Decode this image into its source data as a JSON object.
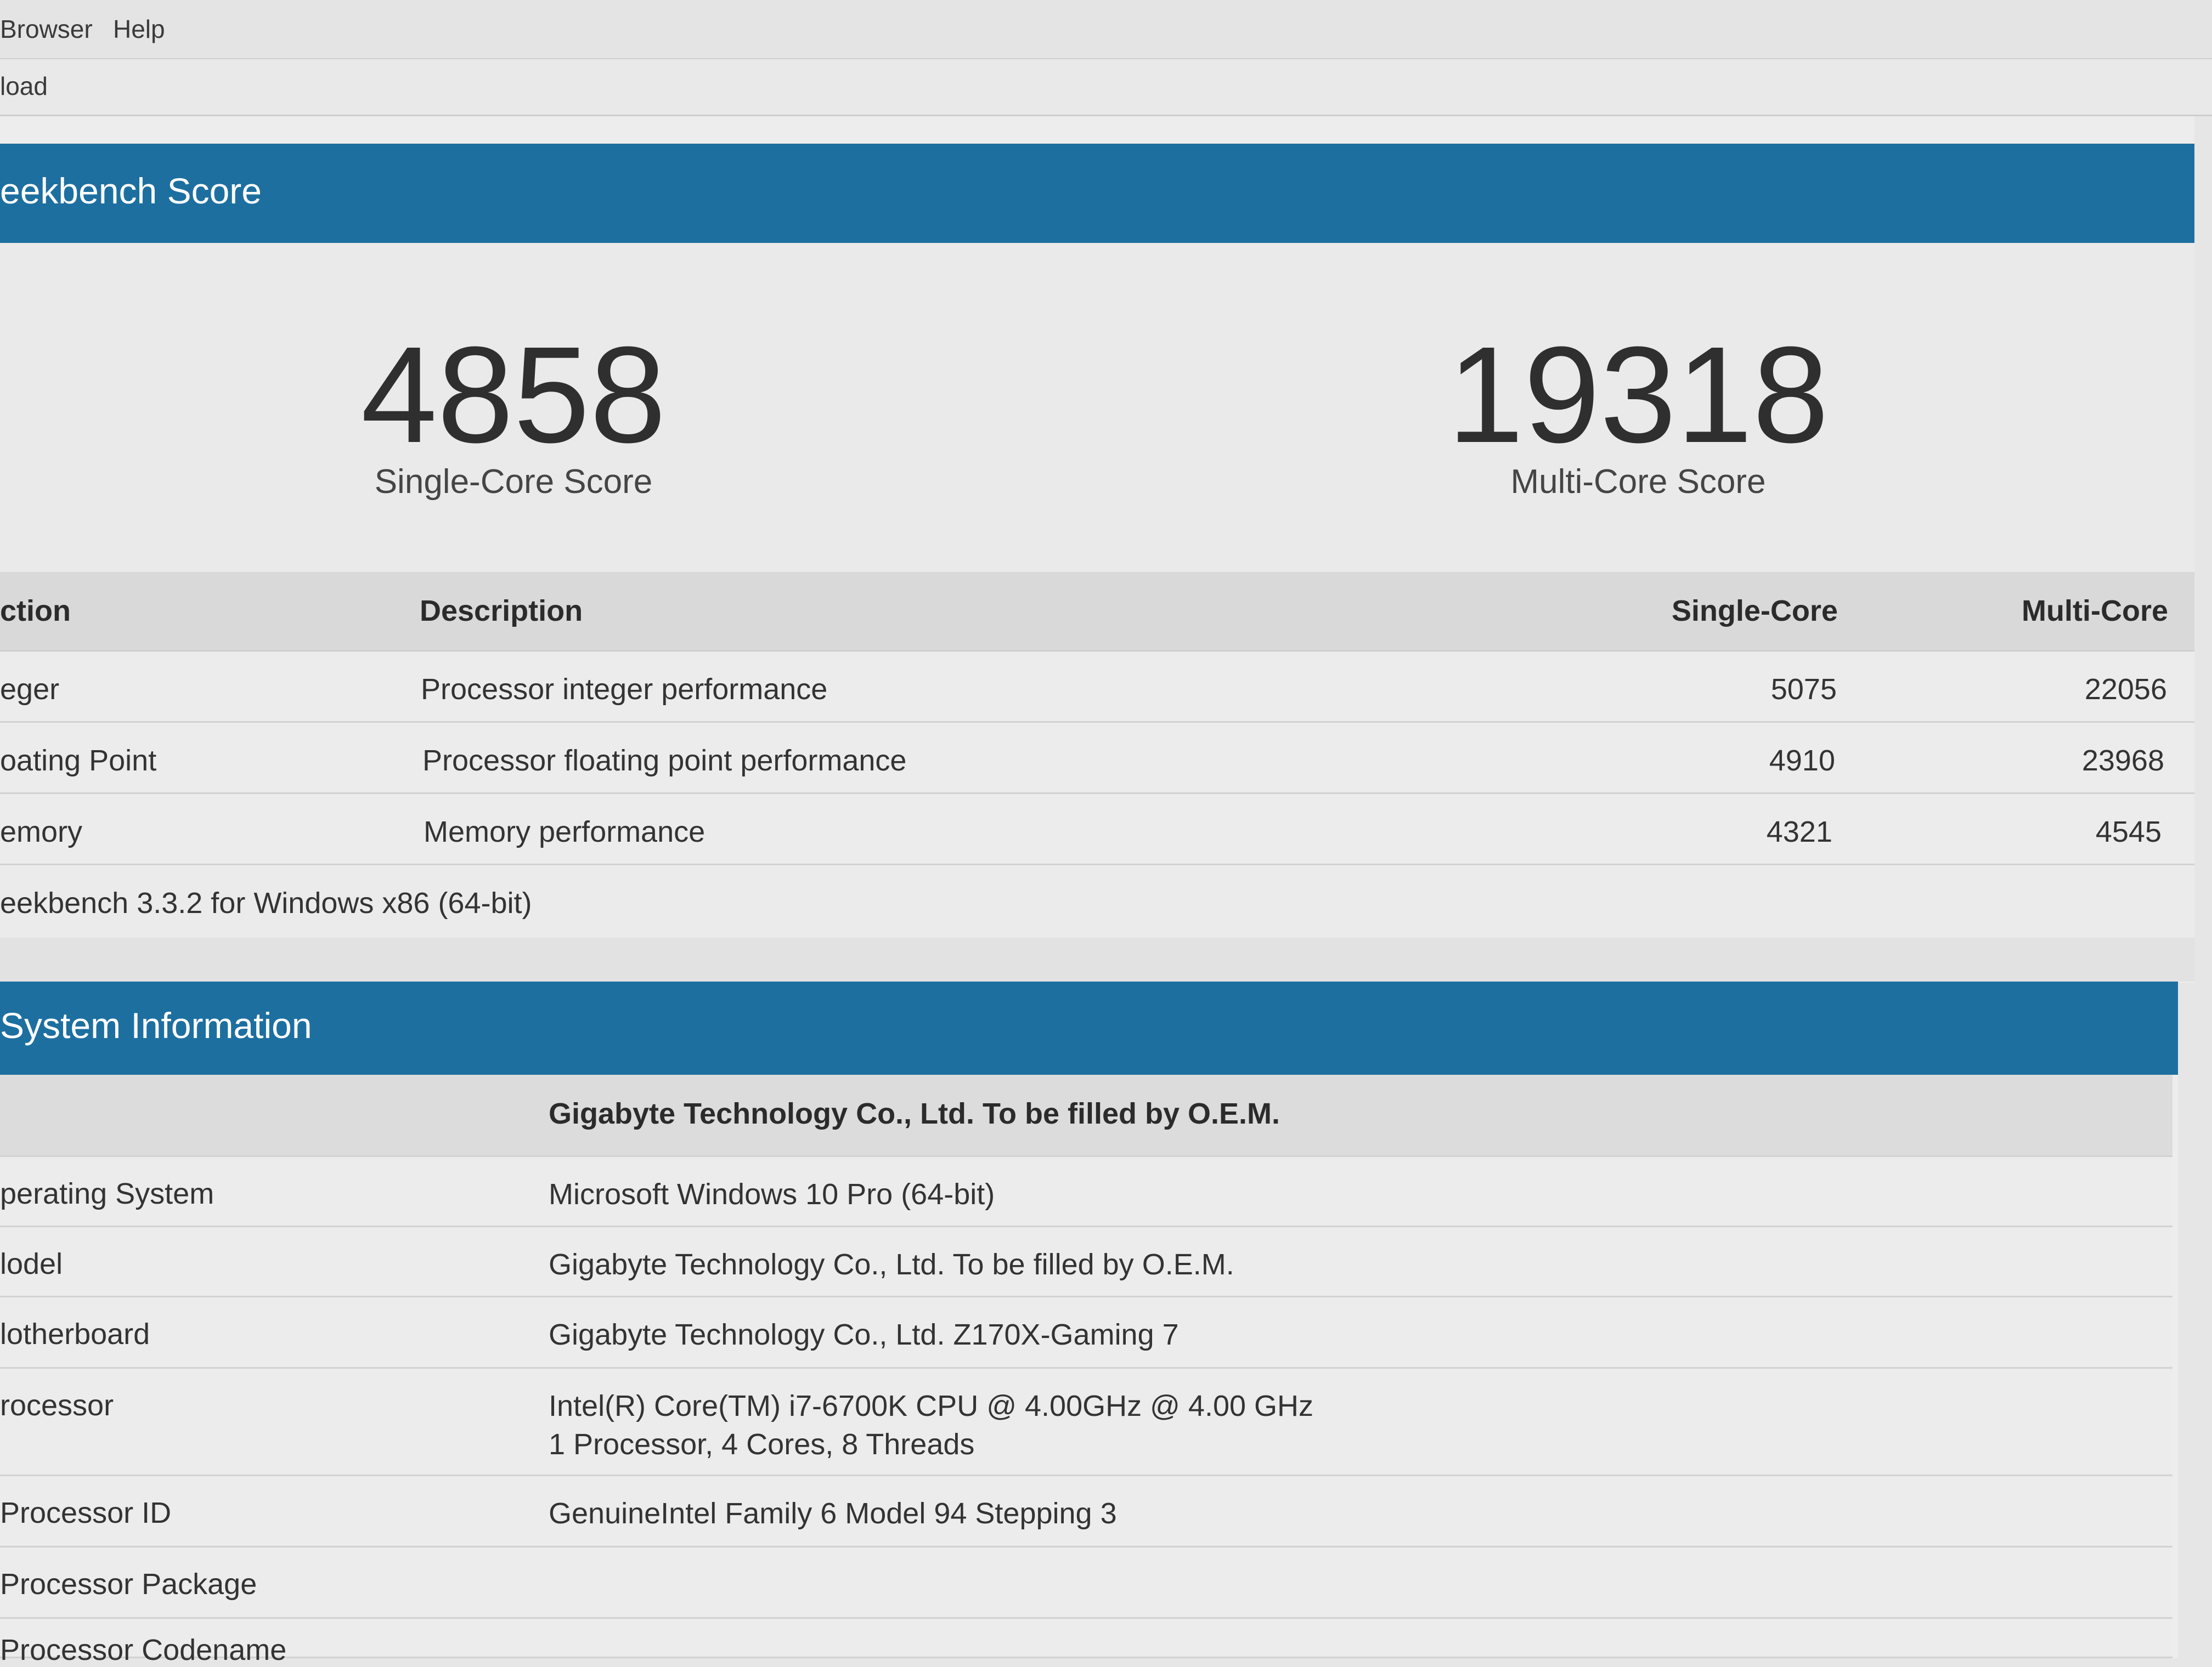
{
  "menu": {
    "items": [
      "Browser",
      "Help"
    ]
  },
  "toolbar": {
    "item": "load"
  },
  "score_section": {
    "title": "eekbench Score",
    "single_core_value": "4858",
    "single_core_label": "Single-Core Score",
    "multi_core_value": "19318",
    "multi_core_label": "Multi-Core Score"
  },
  "score_table": {
    "headers": [
      "ction",
      "Description",
      "Single-Core",
      "Multi-Core"
    ],
    "rows": [
      {
        "section": "eger",
        "description": "Processor integer performance",
        "single": "5075",
        "multi": "22056"
      },
      {
        "section": "oating Point",
        "description": "Processor floating point performance",
        "single": "4910",
        "multi": "23968"
      },
      {
        "section": "emory",
        "description": "Memory performance",
        "single": "4321",
        "multi": "4545"
      }
    ],
    "footer": "eekbench 3.3.2 for Windows x86 (64-bit)"
  },
  "system_section": {
    "title": "System Information",
    "heading": "Gigabyte Technology Co., Ltd. To be filled by O.E.M.",
    "rows": [
      {
        "label": "perating System",
        "value": "Microsoft Windows 10 Pro (64-bit)",
        "value2": ""
      },
      {
        "label": "lodel",
        "value": "Gigabyte Technology Co., Ltd. To be filled by O.E.M.",
        "value2": ""
      },
      {
        "label": "lotherboard",
        "value": "Gigabyte Technology Co., Ltd. Z170X-Gaming 7",
        "value2": ""
      },
      {
        "label": "rocessor",
        "value": "Intel(R) Core(TM) i7-6700K CPU @ 4.00GHz @ 4.00 GHz",
        "value2": "1 Processor, 4 Cores, 8 Threads"
      },
      {
        "label": "Processor ID",
        "value": "GenuineIntel Family 6 Model 94 Stepping 3",
        "value2": ""
      },
      {
        "label": "Processor Package",
        "value": "",
        "value2": ""
      },
      {
        "label": "Processor Codename",
        "value": "",
        "value2": ""
      }
    ]
  }
}
